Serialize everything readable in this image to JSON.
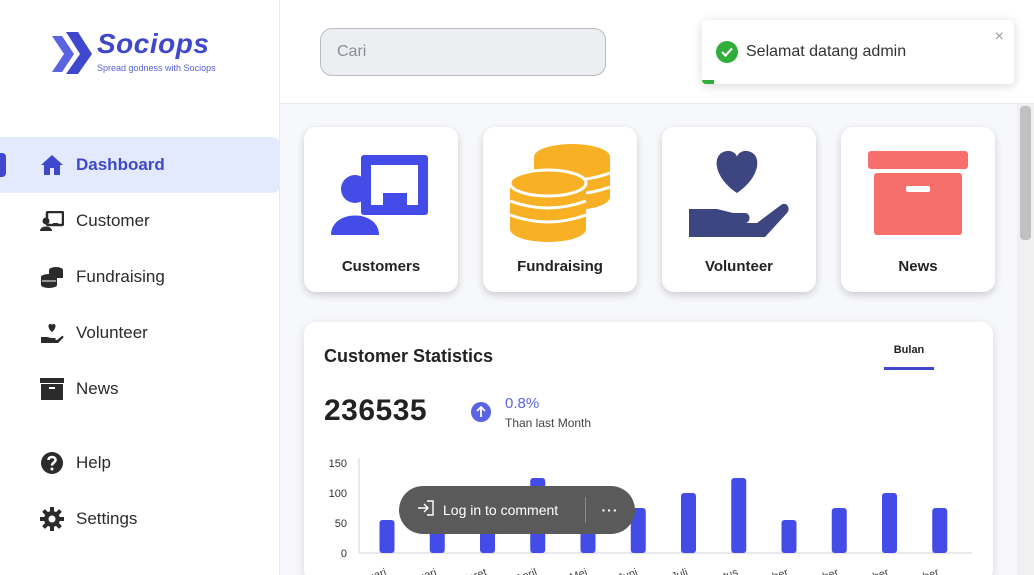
{
  "brand": {
    "name": "Sociops",
    "tagline": "Spread godness with Sociops"
  },
  "search": {
    "placeholder": "Cari"
  },
  "toast": {
    "message": "Selamat datang admin",
    "close": "×",
    "progress": 0.04
  },
  "sidebar": {
    "items": [
      {
        "label": "Dashboard",
        "icon": "home-icon",
        "active": true
      },
      {
        "label": "Customer",
        "icon": "customer-icon"
      },
      {
        "label": "Fundraising",
        "icon": "coins-icon"
      },
      {
        "label": "Volunteer",
        "icon": "heart-hand-icon"
      },
      {
        "label": "News",
        "icon": "archive-box-icon"
      }
    ],
    "bottom_items": [
      {
        "label": "Help",
        "icon": "help-icon"
      },
      {
        "label": "Settings",
        "icon": "gear-icon"
      }
    ]
  },
  "cards": [
    {
      "label": "Customers",
      "icon": "presenter-icon"
    },
    {
      "label": "Fundraising",
      "icon": "coins-stack-icon"
    },
    {
      "label": "Volunteer",
      "icon": "heart-hand-icon"
    },
    {
      "label": "News",
      "icon": "archive-box-icon"
    }
  ],
  "stats": {
    "title": "Customer Statistics",
    "tab": "Bulan",
    "total": "236535",
    "change": "0.8%",
    "change_note": "Than last Month"
  },
  "colors": {
    "accent": "#3f48cc",
    "bar": "#434ce6",
    "coin": "#f8b024",
    "heart": "#3d4680",
    "box": "#f76f6a",
    "success": "#2fae3a"
  },
  "chart_data": {
    "type": "bar",
    "categories": [
      "Januari",
      "Februari",
      "Maret",
      "April",
      "Mei",
      "Juni",
      "Juli",
      "Agustus",
      "September",
      "Oktober",
      "November",
      "Desember"
    ],
    "series": [
      {
        "values": [
          55,
          40,
          40,
          125,
          40,
          75,
          100,
          125,
          55,
          75,
          100,
          75
        ]
      }
    ],
    "yticks": [
      0,
      50,
      100,
      150
    ],
    "ylim": [
      0,
      150
    ],
    "grid": false,
    "title": "",
    "xlabel": "",
    "ylabel": ""
  },
  "overlay": {
    "login_label": "Log in to comment",
    "more": "···"
  }
}
